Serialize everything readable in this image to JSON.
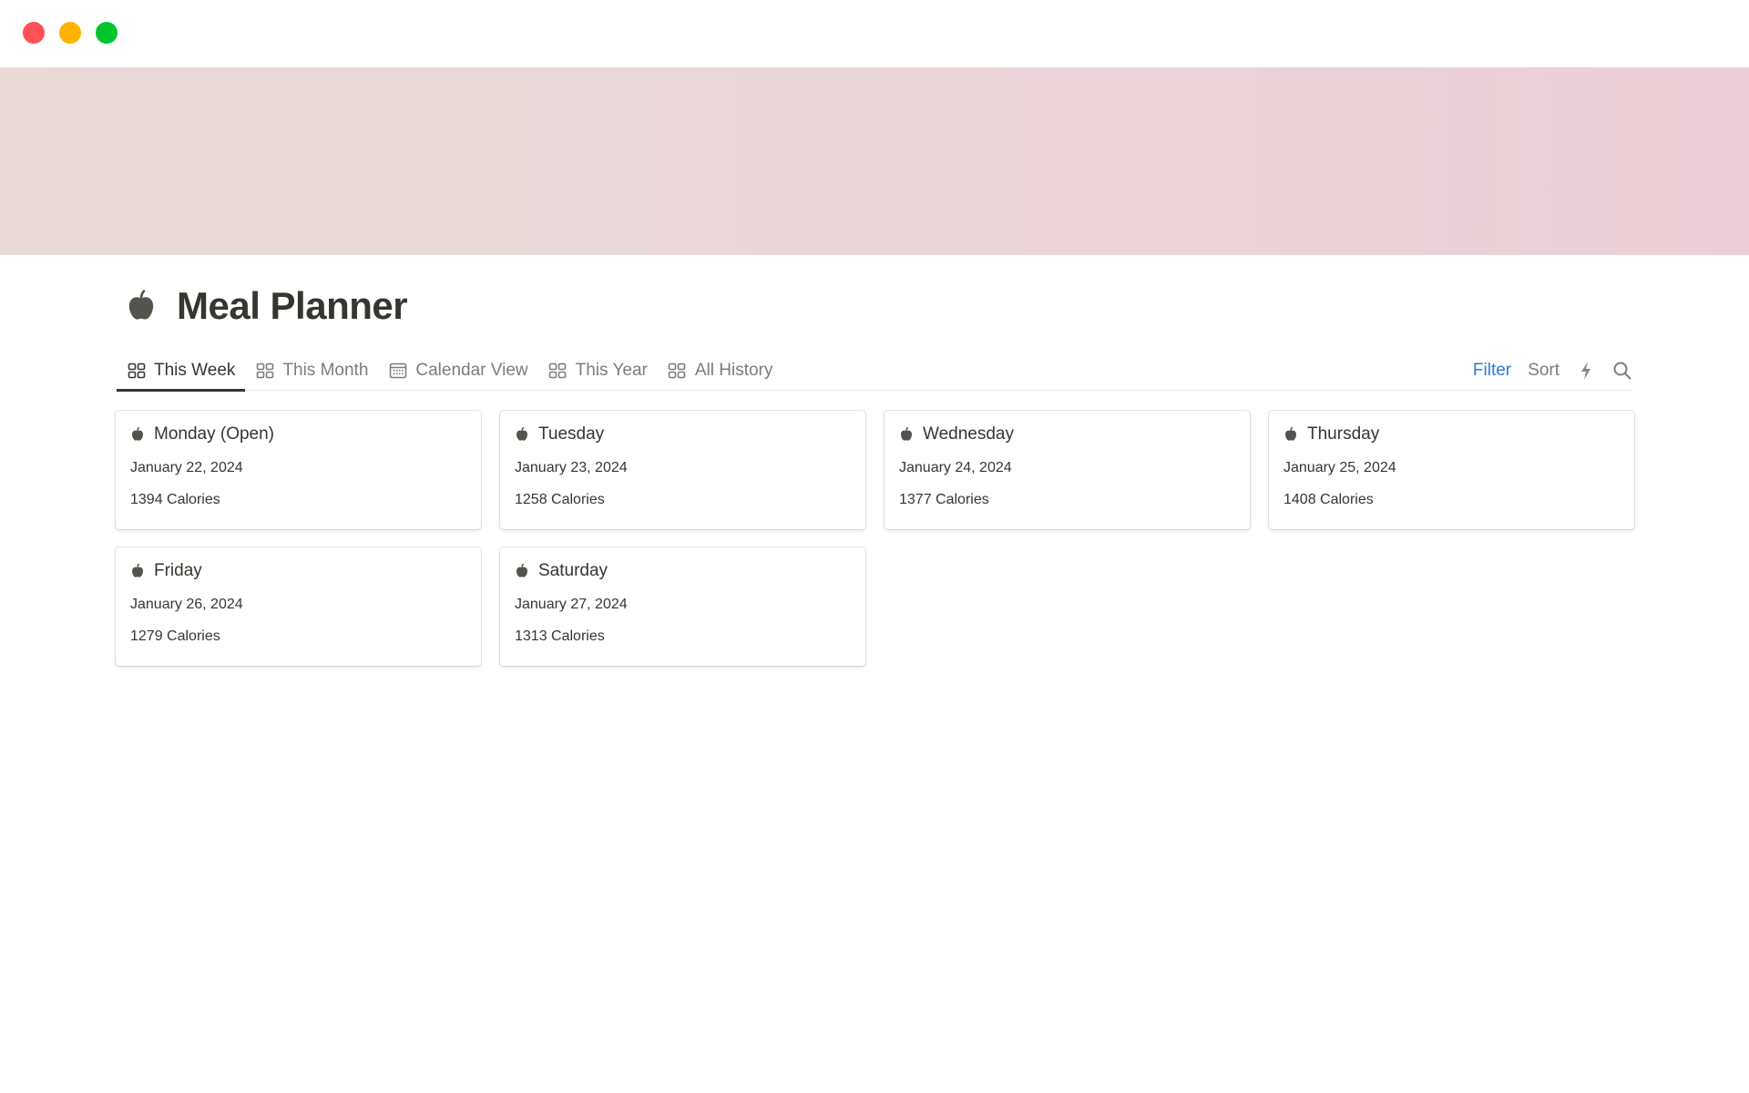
{
  "window": {
    "controls": [
      "close",
      "minimize",
      "maximize"
    ]
  },
  "banner": {
    "gradient_start": "#e8dbd7",
    "gradient_end": "#ebcfd8"
  },
  "page": {
    "icon": "apple-icon",
    "title": "Meal Planner"
  },
  "tabs": [
    {
      "label": "This Week",
      "icon": "gallery-icon",
      "active": true
    },
    {
      "label": "This Month",
      "icon": "gallery-icon",
      "active": false
    },
    {
      "label": "Calendar View",
      "icon": "calendar-icon",
      "active": false
    },
    {
      "label": "This Year",
      "icon": "gallery-icon",
      "active": false
    },
    {
      "label": "All History",
      "icon": "gallery-icon",
      "active": false
    }
  ],
  "actions": {
    "filter_label": "Filter",
    "sort_label": "Sort",
    "automation_icon": "lightning-icon",
    "search_icon": "search-icon",
    "accent_color": "#2f7bd6"
  },
  "cards": [
    {
      "title": "Monday (Open)",
      "date": "January 22, 2024",
      "calories": "1394 Calories"
    },
    {
      "title": "Tuesday",
      "date": "January 23, 2024",
      "calories": "1258 Calories"
    },
    {
      "title": "Wednesday",
      "date": "January 24, 2024",
      "calories": "1377 Calories"
    },
    {
      "title": "Thursday",
      "date": "January 25, 2024",
      "calories": "1408 Calories"
    },
    {
      "title": "Friday",
      "date": "January 26, 2024",
      "calories": "1279 Calories"
    },
    {
      "title": "Saturday",
      "date": "January 27, 2024",
      "calories": "1313 Calories"
    }
  ]
}
